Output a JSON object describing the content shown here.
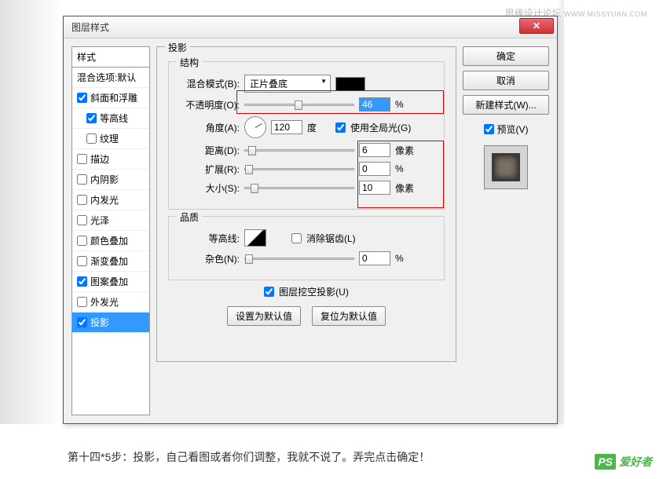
{
  "watermark": {
    "cn": "思缘设计论坛",
    "en": "WWW.MISSYUAN.COM"
  },
  "dialog": {
    "title": "图层样式",
    "left": {
      "header": "样式",
      "blending": "混合选项:默认",
      "items": [
        {
          "label": "斜面和浮雕",
          "checked": true,
          "indent": false
        },
        {
          "label": "等高线",
          "checked": true,
          "indent": true
        },
        {
          "label": "纹理",
          "checked": false,
          "indent": true
        },
        {
          "label": "描边",
          "checked": false,
          "indent": false
        },
        {
          "label": "内阴影",
          "checked": false,
          "indent": false
        },
        {
          "label": "内发光",
          "checked": false,
          "indent": false
        },
        {
          "label": "光泽",
          "checked": false,
          "indent": false
        },
        {
          "label": "颜色叠加",
          "checked": false,
          "indent": false
        },
        {
          "label": "渐变叠加",
          "checked": false,
          "indent": false
        },
        {
          "label": "图案叠加",
          "checked": true,
          "indent": false
        },
        {
          "label": "外发光",
          "checked": false,
          "indent": false
        },
        {
          "label": "投影",
          "checked": true,
          "indent": false,
          "selected": true
        }
      ]
    },
    "panel": {
      "main_title": "投影",
      "structure_title": "结构",
      "blend_mode_label": "混合模式(B):",
      "blend_mode_value": "正片叠底",
      "opacity_label": "不透明度(O):",
      "opacity_value": "46",
      "opacity_unit": "%",
      "angle_label": "角度(A):",
      "angle_value": "120",
      "angle_unit": "度",
      "global_light": "使用全局光(G)",
      "distance_label": "距离(D):",
      "distance_value": "6",
      "distance_unit": "像素",
      "spread_label": "扩展(R):",
      "spread_value": "0",
      "spread_unit": "%",
      "size_label": "大小(S):",
      "size_value": "10",
      "size_unit": "像素",
      "quality_title": "品质",
      "contour_label": "等高线:",
      "antialias": "消除锯齿(L)",
      "noise_label": "杂色(N):",
      "noise_value": "0",
      "noise_unit": "%",
      "knockout": "图层挖空投影(U)",
      "set_default": "设置为默认值",
      "reset_default": "复位为默认值"
    },
    "right": {
      "ok": "确定",
      "cancel": "取消",
      "new_style": "新建样式(W)...",
      "preview": "预览(V)"
    }
  },
  "caption": "第十四*5步：投影，自己看图或者你们调整，我就不说了。弄完点击确定！",
  "logo": {
    "ps": "PS",
    "txt": "爱好者"
  }
}
